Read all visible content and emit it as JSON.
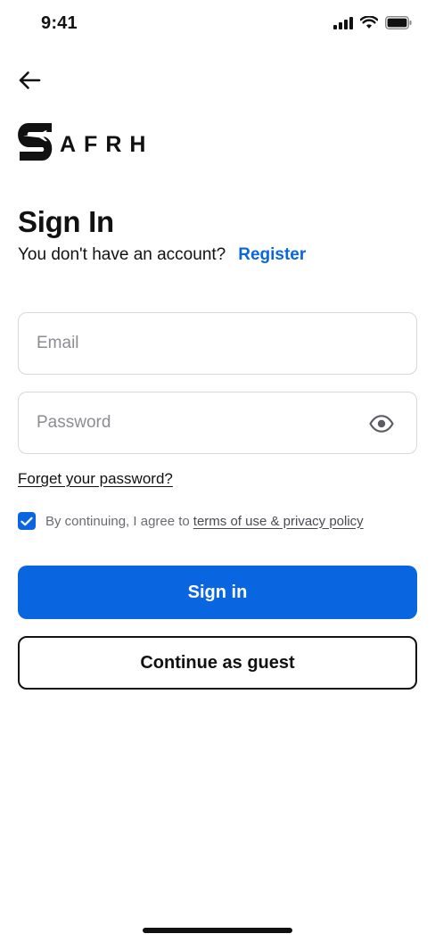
{
  "status_bar": {
    "time": "9:41",
    "icons": [
      "signal-icon",
      "wifi-icon",
      "battery-icon"
    ]
  },
  "header": {
    "back_icon": "arrow-left-icon"
  },
  "logo": {
    "text": "AFRH",
    "mark": "s-plane-logo-mark"
  },
  "page": {
    "title": "Sign In",
    "subtitle": "You don't have an account?",
    "register_label": "Register"
  },
  "form": {
    "email_placeholder": "Email",
    "email_value": "",
    "password_placeholder": "Password",
    "password_value": "",
    "password_toggle_icon": "eye-icon",
    "forgot_label": "Forget your password?",
    "agree_checked": true,
    "agree_text": "By continuing, I agree to",
    "terms_label": "terms of use & privacy policy"
  },
  "actions": {
    "signin_label": "Sign in",
    "guest_label": "Continue as guest"
  },
  "colors": {
    "primary": "#0a66e0",
    "text": "#111111",
    "muted": "#8c8c93",
    "border": "#d7d7dc"
  }
}
